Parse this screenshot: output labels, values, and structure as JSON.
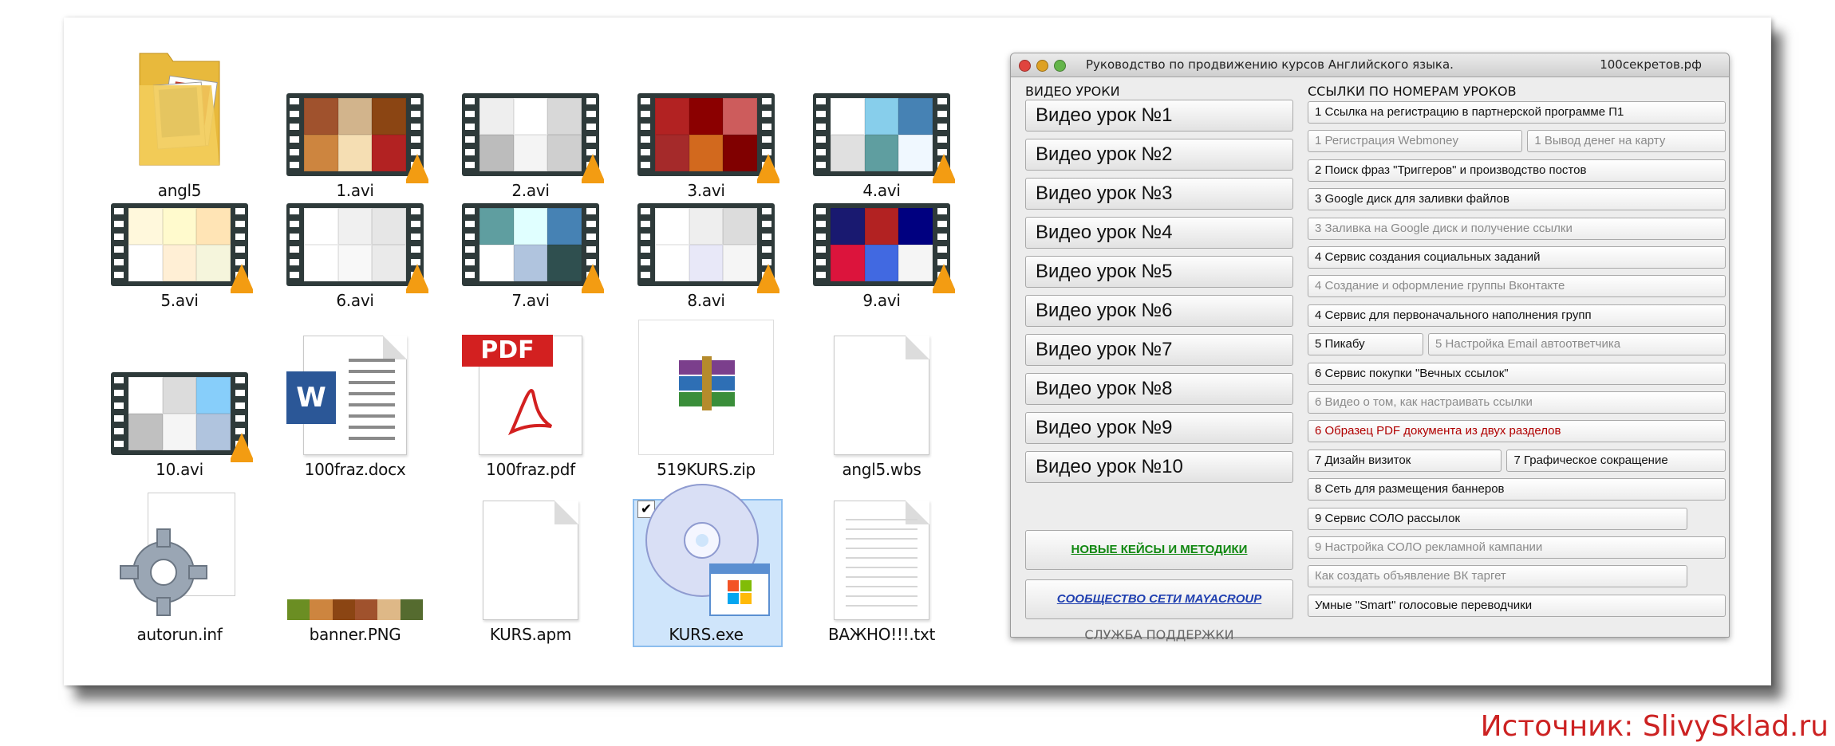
{
  "files": [
    {
      "name": "angl5",
      "kind": "folder"
    },
    {
      "name": "1.avi",
      "kind": "video",
      "palette": [
        "#a0522d",
        "#d2b48c",
        "#8b4513",
        "#cd853f",
        "#f5deb3",
        "#b22222"
      ]
    },
    {
      "name": "2.avi",
      "kind": "video",
      "palette": [
        "#eeeeee",
        "#ffffff",
        "#d8d8d8",
        "#bcbcbc",
        "#f4f4f4",
        "#cfcfcf"
      ]
    },
    {
      "name": "3.avi",
      "kind": "video",
      "palette": [
        "#b22222",
        "#8b0000",
        "#cd5c5c",
        "#a52a2a",
        "#d2691e",
        "#800000"
      ]
    },
    {
      "name": "4.avi",
      "kind": "video",
      "palette": [
        "#ffffff",
        "#87ceeb",
        "#4682b4",
        "#e0e0e0",
        "#5f9ea0",
        "#f0f8ff"
      ]
    },
    {
      "name": "5.avi",
      "kind": "video",
      "palette": [
        "#fff8dc",
        "#fffacd",
        "#ffe4b5",
        "#ffffff",
        "#ffefd5",
        "#f5f5dc"
      ]
    },
    {
      "name": "6.avi",
      "kind": "video",
      "palette": [
        "#ffffff",
        "#f0f0f0",
        "#e6e6e6",
        "#ffffff",
        "#f8f8f8",
        "#eaeaea"
      ]
    },
    {
      "name": "7.avi",
      "kind": "video",
      "palette": [
        "#5f9ea0",
        "#e0ffff",
        "#4682b4",
        "#ffffff",
        "#b0c4de",
        "#2f4f4f"
      ]
    },
    {
      "name": "8.avi",
      "kind": "video",
      "palette": [
        "#ffffff",
        "#eeeeee",
        "#dcdcdc",
        "#ffffff",
        "#e8e8f8",
        "#f5f5f5"
      ]
    },
    {
      "name": "9.avi",
      "kind": "video",
      "palette": [
        "#191970",
        "#b22222",
        "#000080",
        "#dc143c",
        "#4169e1",
        "#f5f5f5"
      ]
    },
    {
      "name": "10.avi",
      "kind": "video",
      "palette": [
        "#ffffff",
        "#dcdcdc",
        "#87cefa",
        "#c0c0c0",
        "#f5f5f5",
        "#b0c4de"
      ]
    },
    {
      "name": "100fraz.docx",
      "kind": "word"
    },
    {
      "name": "100fraz.pdf",
      "kind": "pdf",
      "badge": "PDF"
    },
    {
      "name": "519KURS.zip",
      "kind": "zip"
    },
    {
      "name": "angl5.wbs",
      "kind": "blank"
    },
    {
      "name": "autorun.inf",
      "kind": "gear"
    },
    {
      "name": "banner.PNG",
      "kind": "banner"
    },
    {
      "name": "KURS.apm",
      "kind": "blank"
    },
    {
      "name": "KURS.exe",
      "kind": "exe",
      "selected": true,
      "check": "✔"
    },
    {
      "name": "ВАЖНО!!!.txt",
      "kind": "text"
    }
  ],
  "window": {
    "title": "Руководство по продвижению курсов Английского языка.",
    "site": "100секретов.рф",
    "video_header": "ВИДЕО УРОКИ",
    "links_header": "ССЫЛКИ ПО НОМЕРАМ УРОКОВ",
    "video_buttons": [
      "Видео урок №1",
      "Видео урок №2",
      "Видео урок №3",
      "Видео урок №4",
      "Видео урок №5",
      "Видео урок №6",
      "Видео урок №7",
      "Видео урок №8",
      "Видео урок №9",
      "Видео урок №10"
    ],
    "cases_button": "НОВЫЕ КЕЙСЫ И МЕТОДИКИ",
    "community_button": "СООБЩЕСТВО СЕТИ MAYACROUP",
    "support_label": "СЛУЖБА ПОДДЕРЖКИ",
    "link_rows": [
      [
        {
          "text": "1 Ссылка на регистрацию в партнерской программе П1",
          "style": "normal"
        }
      ],
      [
        {
          "text": "1 Регистрация Webmoney",
          "style": "dim"
        },
        {
          "text": "1 Вывод денег на карту",
          "style": "dim"
        }
      ],
      [
        {
          "text": "2 Поиск фраз \"Триггеров\" и производство постов",
          "style": "normal"
        }
      ],
      [
        {
          "text": "3 Google диск для заливки файлов",
          "style": "normal"
        }
      ],
      [
        {
          "text": "3 Заливка на Google диск и получение ссылки",
          "style": "dim"
        }
      ],
      [
        {
          "text": "4 Сервис создания социальных заданий",
          "style": "normal"
        }
      ],
      [
        {
          "text": "4 Создание и оформление группы Вконтакте",
          "style": "dim"
        }
      ],
      [
        {
          "text": "4 Сервис для первоначального наполнения групп",
          "style": "normal"
        }
      ],
      [
        {
          "text": "5 Пикабу",
          "style": "normal"
        },
        {
          "text": "5 Настройка Email автоответчика",
          "style": "dim"
        }
      ],
      [
        {
          "text": "6 Сервис покупки \"Вечных ссылок\"",
          "style": "normal"
        }
      ],
      [
        {
          "text": "6 Видео о том, как настраивать ссылки",
          "style": "dim"
        }
      ],
      [
        {
          "text": "6 Образец PDF документа из двух разделов",
          "style": "red"
        }
      ],
      [
        {
          "text": "7 Дизайн визиток",
          "style": "normal"
        },
        {
          "text": "7 Графическое сокращение",
          "style": "normal"
        }
      ],
      [
        {
          "text": "8 Сеть для размещения баннеров",
          "style": "normal"
        }
      ],
      [
        {
          "text": "9 Сервис СОЛО рассылок",
          "style": "normal"
        }
      ],
      [
        {
          "text": "9 Настройка СОЛО рекламной кампании",
          "style": "dim"
        }
      ],
      [
        {
          "text": "Как создать объявление ВК таргет",
          "style": "dim"
        }
      ],
      [
        {
          "text": "Умные \"Smart\" голосовые переводчики",
          "style": "normal"
        }
      ]
    ]
  },
  "source": "Источник: SlivySklad.ru",
  "colors": {
    "cases_link": "#118811",
    "community_link": "#1f3fb0",
    "source_text": "#cc2222",
    "selection_bg": "#cfe5fb"
  }
}
